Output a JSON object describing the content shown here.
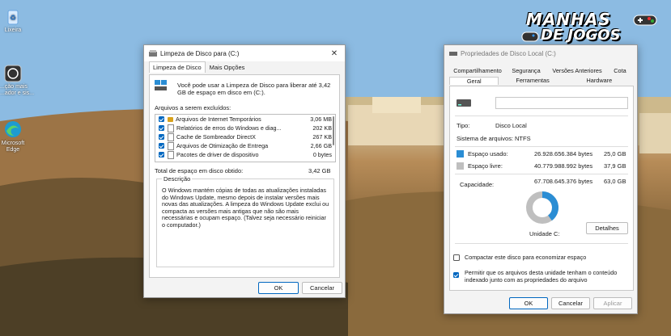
{
  "desktop": {
    "icons": [
      {
        "name": "recycle-bin",
        "label": "Lixeira"
      },
      {
        "name": "shortcut",
        "label": "...ção mais\n...ador e sis..."
      },
      {
        "name": "edge",
        "label": "Microsoft\nEdge"
      }
    ]
  },
  "watermark": {
    "line1": "MANHAS",
    "line2": "DE JOGOS"
  },
  "cleanup": {
    "title": "Limpeza de Disco para  (C:)",
    "tabs": [
      "Limpeza de Disco",
      "Mais Opções"
    ],
    "intro": "Você pode usar a Limpeza de Disco para liberar até 3,42 GB de espaço em disco em  (C:).",
    "files_label": "Arquivos a serem excluídos:",
    "files": [
      {
        "name": "Arquivos de Internet Temporários",
        "size": "3,06 MB",
        "checked": true,
        "icon": "lock"
      },
      {
        "name": "Relatórios de erros do Windows e diag...",
        "size": "202 KB",
        "checked": true,
        "icon": "doc"
      },
      {
        "name": "Cache de Sombreador DirectX",
        "size": "267 KB",
        "checked": true,
        "icon": "doc"
      },
      {
        "name": "Arquivos de Otimização de Entrega",
        "size": "2,66 GB",
        "checked": true,
        "icon": "doc"
      },
      {
        "name": "Pacotes de driver de dispositivo",
        "size": "0 bytes",
        "checked": true,
        "icon": "doc"
      }
    ],
    "total_label": "Total de espaço em disco obtido:",
    "total_value": "3,42 GB",
    "desc_title": "Descrição",
    "desc_text": "O Windows mantém cópias de todas as atualizações instaladas do Windows Update, mesmo depois de instalar versões mais novas das atualizações. A limpeza do Windows Update exclui ou compacta as versões mais antigas que não são mais necessárias e ocupam espaço. (Talvez seja necessário reiniciar o computador.)",
    "ok": "OK",
    "cancel": "Cancelar"
  },
  "props": {
    "title": "Propriedades de Disco Local (C:)",
    "tabs_row1": [
      "Compartilhamento",
      "Segurança",
      "Versões Anteriores",
      "Cota"
    ],
    "tabs_row2": [
      "Geral",
      "Ferramentas",
      "Hardware"
    ],
    "type_label": "Tipo:",
    "type_value": "Disco Local",
    "fs_label": "Sistema de arquivos:",
    "fs_value": "NTFS",
    "used_label": "Espaço usado:",
    "used_bytes": "26.928.656.384 bytes",
    "used_gb": "25,0 GB",
    "free_label": "Espaço livre:",
    "free_bytes": "40.779.988.992 bytes",
    "free_gb": "37,9 GB",
    "cap_label": "Capacidade:",
    "cap_bytes": "67.708.645.376 bytes",
    "cap_gb": "63,0 GB",
    "used_fraction": 0.398,
    "drive_label": "Unidade C:",
    "details": "Detalhes",
    "compress": "Compactar este disco para economizar espaço",
    "index": "Permitir que os arquivos desta unidade tenham o conteúdo indexado junto com as propriedades do arquivo",
    "ok": "OK",
    "cancel": "Cancelar",
    "apply": "Aplicar",
    "colors": {
      "used": "#2a8dd4",
      "free": "#bfbfbf"
    }
  }
}
